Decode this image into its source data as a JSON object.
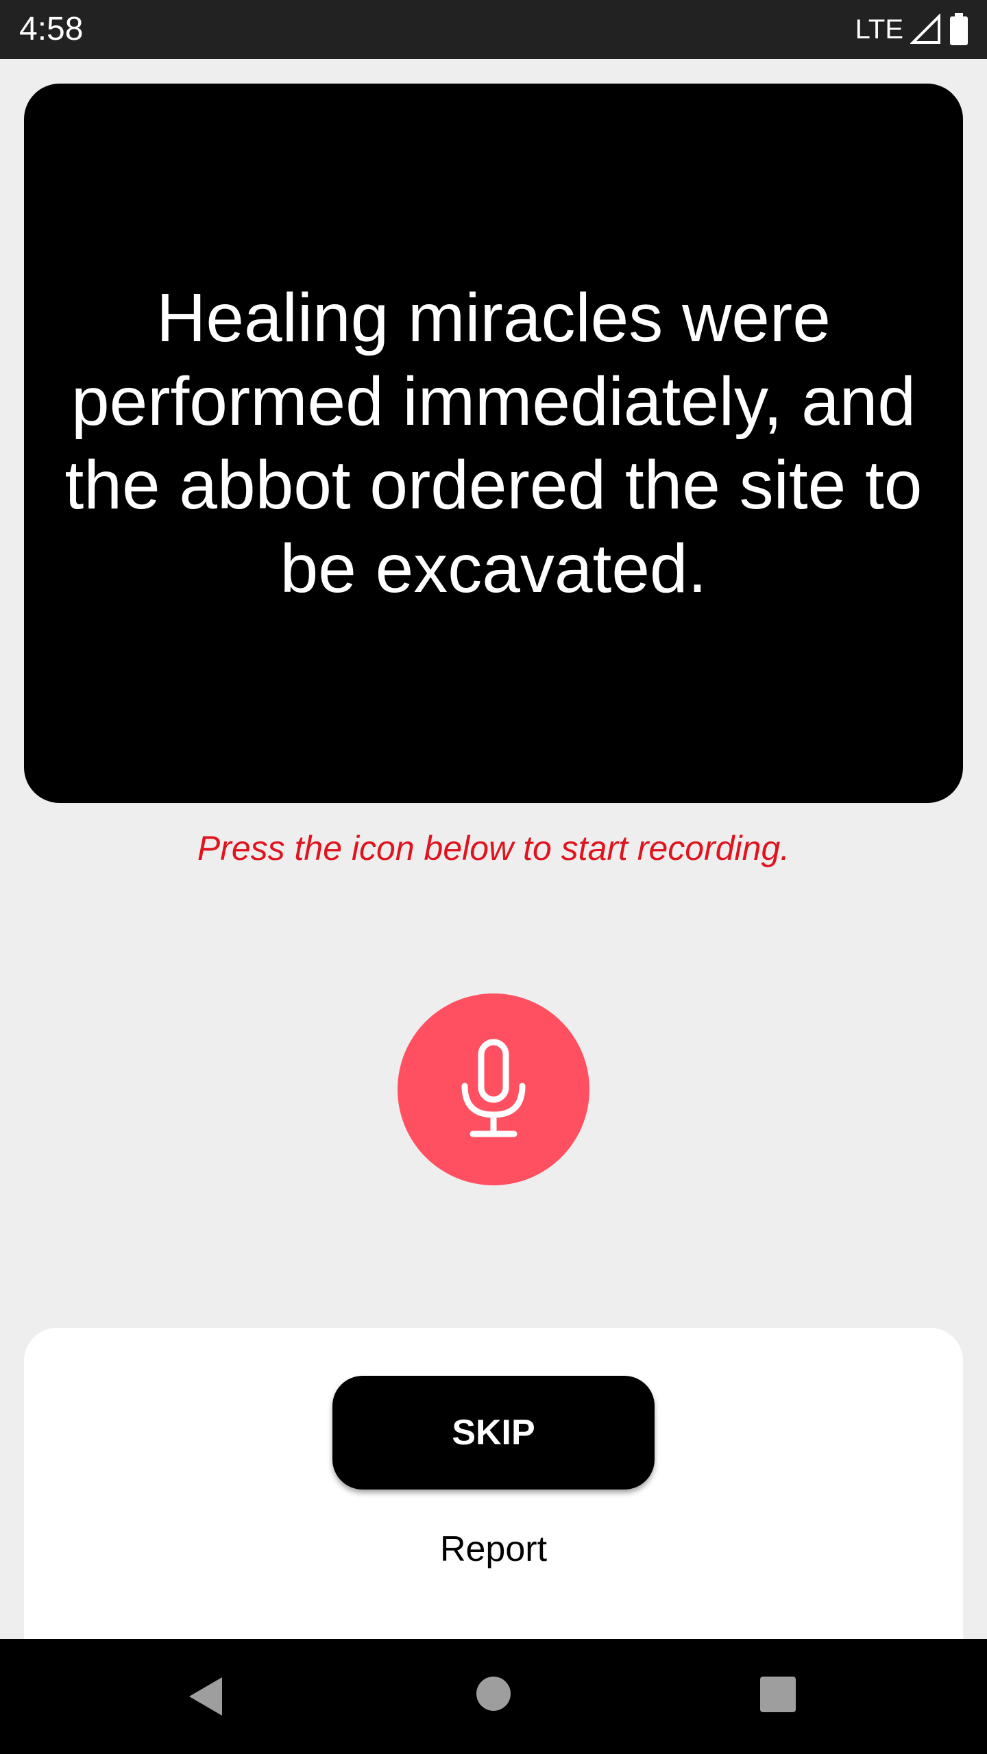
{
  "status_bar": {
    "time": "4:58",
    "network": "LTE",
    "icons": [
      "signal-icon",
      "battery-icon"
    ]
  },
  "prompt": {
    "text": "Healing miracles were performed immediately, and the abbot ordered the site to be excavated."
  },
  "hint": {
    "text": "Press the icon below to start recording."
  },
  "record": {
    "icon": "microphone-icon",
    "color": "#ff5061"
  },
  "actions": {
    "skip_label": "SKIP",
    "report_label": "Report"
  },
  "nav_bar": {
    "icons": [
      "back-icon",
      "home-icon",
      "recents-icon"
    ]
  },
  "colors": {
    "background": "#eeeeee",
    "status_bar": "#222222",
    "card": "#000000",
    "hint": "#e0141e",
    "panel": "#ffffff"
  }
}
